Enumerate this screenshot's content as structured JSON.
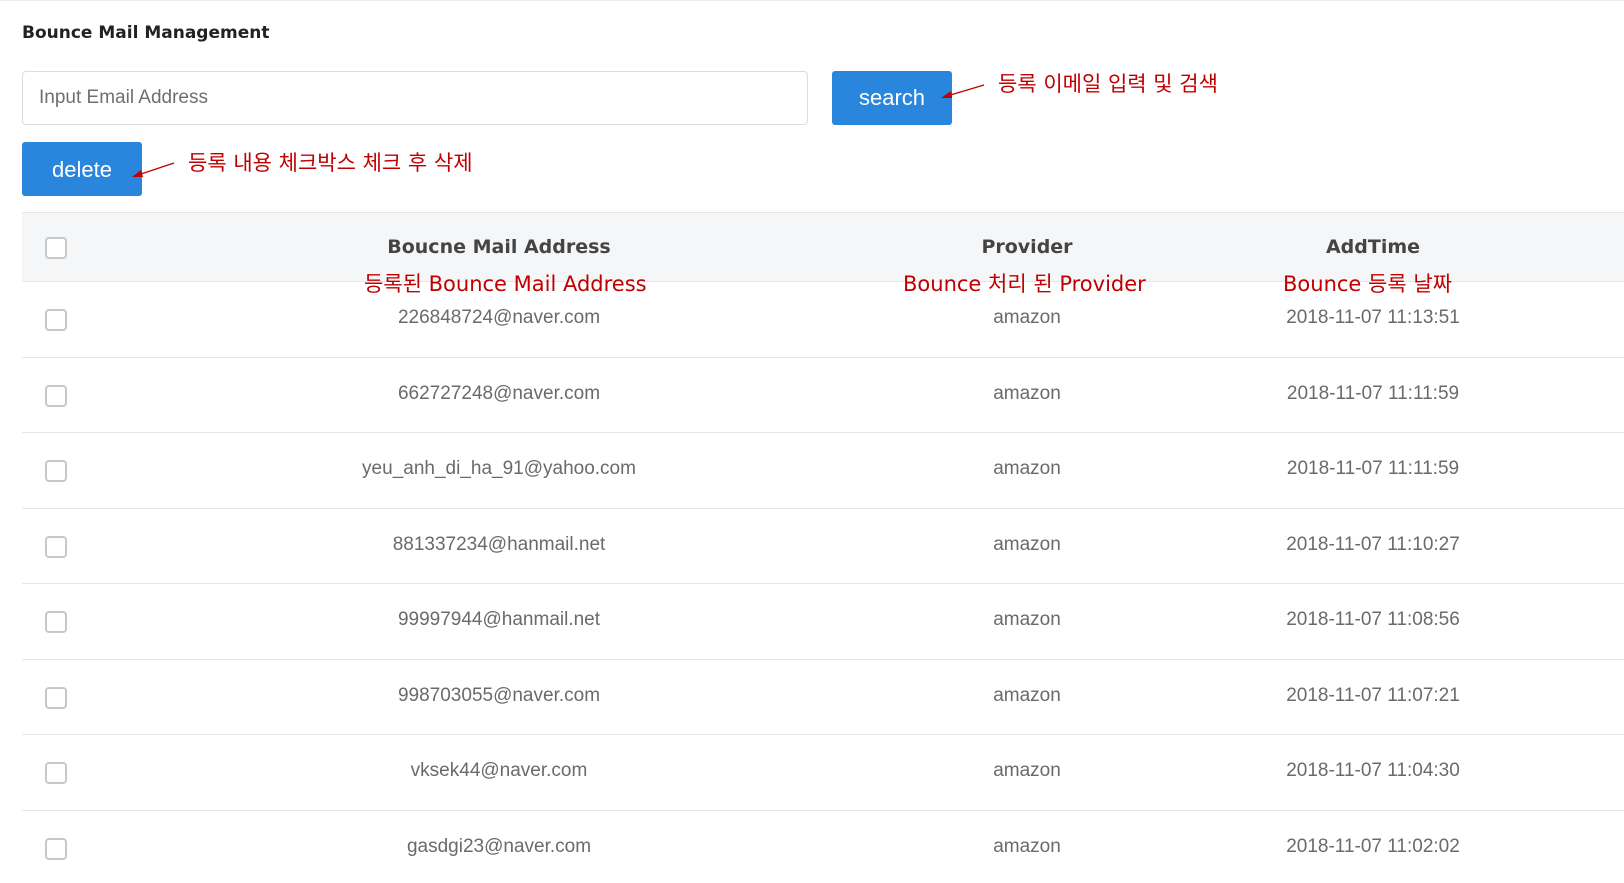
{
  "page": {
    "title": "Bounce Mail Management"
  },
  "search": {
    "placeholder": "Input Email Address",
    "value": "",
    "button_label": "search"
  },
  "actions": {
    "delete_label": "delete"
  },
  "annotations": {
    "search_note": "등록 이메일 입력 및 검색",
    "delete_note": "등록 내용 체크박스 체크 후 삭제",
    "email_col_note": "등록된 Bounce Mail Address",
    "provider_col_note": "Bounce 처리 된 Provider",
    "time_col_note": "Bounce 등록 날짜",
    "color": "#c00000"
  },
  "table": {
    "columns": [
      "Boucne Mail Address",
      "Provider",
      "AddTime"
    ],
    "rows": [
      {
        "email": "226848724@naver.com",
        "provider": "amazon",
        "addtime": "2018-11-07 11:13:51"
      },
      {
        "email": "662727248@naver.com",
        "provider": "amazon",
        "addtime": "2018-11-07 11:11:59"
      },
      {
        "email": "yeu_anh_di_ha_91@yahoo.com",
        "provider": "amazon",
        "addtime": "2018-11-07 11:11:59"
      },
      {
        "email": "881337234@hanmail.net",
        "provider": "amazon",
        "addtime": "2018-11-07 11:10:27"
      },
      {
        "email": "99997944@hanmail.net",
        "provider": "amazon",
        "addtime": "2018-11-07 11:08:56"
      },
      {
        "email": "998703055@naver.com",
        "provider": "amazon",
        "addtime": "2018-11-07 11:07:21"
      },
      {
        "email": "vksek44@naver.com",
        "provider": "amazon",
        "addtime": "2018-11-07 11:04:30"
      },
      {
        "email": "gasdgi23@naver.com",
        "provider": "amazon",
        "addtime": "2018-11-07 11:02:02"
      }
    ]
  },
  "colors": {
    "primary_button": "#2a86dc",
    "header_bg": "#f5f6f8",
    "row_border": "#e6e6e6"
  }
}
